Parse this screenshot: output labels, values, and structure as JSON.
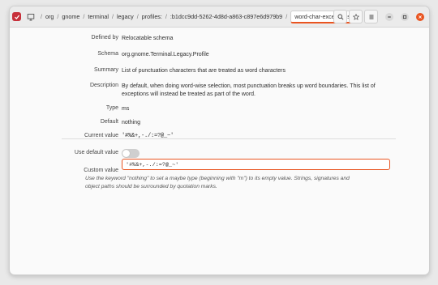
{
  "header": {
    "breadcrumbs": [
      "org",
      "gnome",
      "terminal",
      "legacy",
      "profiles:",
      ":b1dcc9dd-5262-4d8d-a863-c897e6d979b9"
    ],
    "active_crumb": "word-char-exceptions"
  },
  "fields": {
    "defined_by": {
      "label": "Defined by",
      "value": "Relocatable schema"
    },
    "schema": {
      "label": "Schema",
      "value": "org.gnome.Terminal.Legacy.Profile"
    },
    "summary": {
      "label": "Summary",
      "value": "List of punctuation characters that are treated as word characters"
    },
    "description": {
      "label": "Description",
      "value": "By default, when doing word-wise selection, most punctuation breaks up word boundaries. This list of exceptions will instead be treated as part of the word."
    },
    "type": {
      "label": "Type",
      "value": "ms"
    },
    "default": {
      "label": "Default",
      "value": "nothing"
    },
    "current_value": {
      "label": "Current value",
      "value": "'#%&+,-./:=?@_~'"
    }
  },
  "use_default": {
    "label": "Use default value",
    "on": false
  },
  "custom_value": {
    "label": "Custom value",
    "value": "'#%&+,-./:=?@_~'"
  },
  "help_text": "Use the keyword \"nothing\" to set a maybe type (beginning with \"m\") to its empty value. Strings, signatures and object paths should be surrounded by quotation marks.",
  "colors": {
    "accent": "#e95420",
    "app_icon": "#c7303a"
  }
}
